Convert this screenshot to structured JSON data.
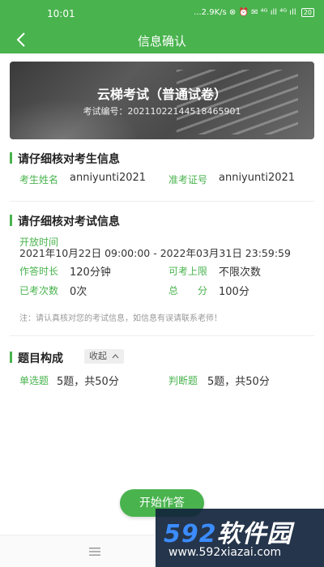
{
  "status_bar": {
    "time": "10:01",
    "indicators": "...2.9K/s ⊗ ⏰ ✉ ⁴ᴳ ıll ⁴ᴳ ıll",
    "battery": "20"
  },
  "nav": {
    "title": "信息确认",
    "back_icon": "chevron-left-icon"
  },
  "banner": {
    "title": "云梯考试（普通试卷）",
    "exam_no_label": "考试编号：",
    "exam_no": "20211022144518465901"
  },
  "candidate": {
    "heading": "请仔细核对考生信息",
    "name_label": "考生姓名",
    "name": "anniyunti2021",
    "ticket_label": "准考证号",
    "ticket": "anniyunti2021"
  },
  "exam": {
    "heading": "请仔细核对考试信息",
    "open_time_label": "开放时间",
    "open_time": "2021年10月22日 09:00:00 - 2022年03月31日 23:59:59",
    "duration_label": "作答时长",
    "duration": "120分钟",
    "limit_label": "可考上限",
    "limit": "不限次数",
    "taken_label": "已考次数",
    "taken": "0次",
    "total_label": "总　　分",
    "total": "100分",
    "note": "注：请认真核对您的考试信息，如信息有误请联系老师！"
  },
  "composition": {
    "heading": "题目构成",
    "collapse_label": "收起",
    "collapse_icon": "chevron-up-icon",
    "single_label": "单选题",
    "single_value": "5题，共50分",
    "judge_label": "判断题",
    "judge_value": "5题，共50分"
  },
  "actions": {
    "start_label": "开始作答"
  },
  "watermark": {
    "brand_num": "592",
    "brand_text": "软件园",
    "url": "www.592xiazai.com"
  },
  "colors": {
    "accent": "#49b34e",
    "label_green": "#49b34e",
    "watermark_bg": "#12243c",
    "watermark_num": "#3b8cff"
  }
}
